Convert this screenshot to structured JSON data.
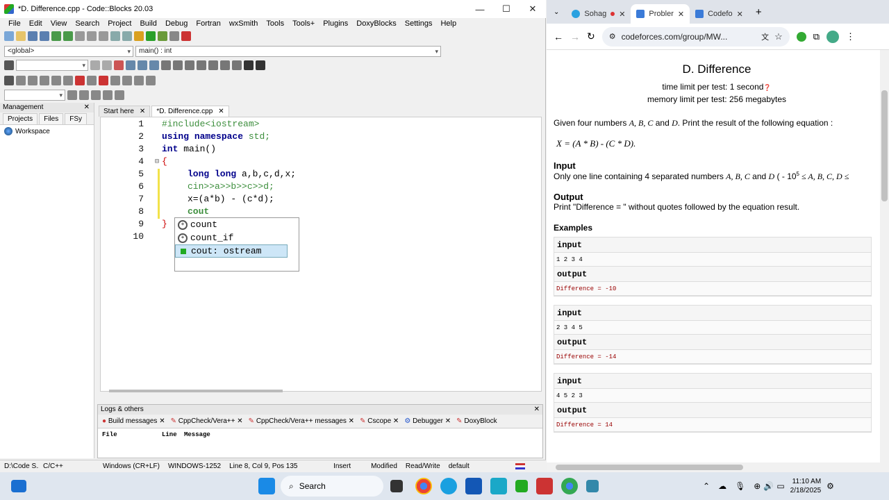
{
  "ide": {
    "window_title": "*D. Difference.cpp - Code::Blocks 20.03",
    "menu": [
      "File",
      "Edit",
      "View",
      "Search",
      "Project",
      "Build",
      "Debug",
      "Fortran",
      "wxSmith",
      "Tools",
      "Tools+",
      "Plugins",
      "DoxyBlocks",
      "Settings",
      "Help"
    ],
    "scope_combo": "<global>",
    "function_combo": "main() : int",
    "management": {
      "title": "Management",
      "tabs": [
        "Projects",
        "Files",
        "FSy"
      ],
      "tree_root": "Workspace"
    },
    "editor_tabs": [
      "Start here",
      "*D. Difference.cpp"
    ],
    "line_numbers": [
      "1",
      "2",
      "3",
      "4",
      "5",
      "6",
      "7",
      "8",
      "9",
      "10"
    ],
    "code": {
      "l1": "#include<iostream>",
      "l2_kw1": "using",
      "l2_kw2": "namespace",
      "l2_rest": "std;",
      "l3_kw": "int",
      "l3_rest": "main()",
      "l4": "{",
      "l5_kw": "long long",
      "l5_rest": "a,b,c,d,x;",
      "l6": "cin>>a>>b>>c>>d;",
      "l7": "x=(a*b) - (c*d);",
      "l8": "cout",
      "l9": "}"
    },
    "autocomplete": [
      "count",
      "count_if",
      "cout: ostream"
    ],
    "logs": {
      "title": "Logs & others",
      "tabs": [
        "Build messages",
        "CppCheck/Vera++",
        "CppCheck/Vera++ messages",
        "Cscope",
        "Debugger",
        "DoxyBlock"
      ],
      "columns": [
        "File",
        "Line",
        "Message"
      ]
    },
    "status": [
      "D:\\Code S...",
      "C/C++",
      "Windows (CR+LF)",
      "WINDOWS-1252",
      "Line 8, Col 9, Pos 135",
      "Insert",
      "Modified",
      "Read/Write",
      "default"
    ]
  },
  "browser": {
    "tabs": [
      "Sohag",
      "Probler",
      "Codefo"
    ],
    "url": "codeforces.com/group/MW...",
    "problem": {
      "title": "D. Difference",
      "time_limit": "time limit per test: 1 second",
      "memory_limit": "memory limit per test: 256 megabytes",
      "statement_pre": "Given four numbers ",
      "statement_vars": "A, B, C",
      "statement_and": " and ",
      "statement_d": "D",
      "statement_post": ". Print the result of the following equation :",
      "equation": "X = (A * B) - (C * D).",
      "input_title": "Input",
      "input_pre": "Only one line containing 4 separated numbers ",
      "input_vars": "A, B, C",
      "input_and": " and ",
      "input_d": "D",
      "input_range": " ( - 10",
      "input_exp": "5",
      "input_range2": " ≤ A, B, C, D ≤",
      "output_title": "Output",
      "output_text": "Print \"Difference = \" without quotes followed by the equation result.",
      "examples_title": "Examples",
      "examples": [
        {
          "input_label": "input",
          "input": "1 2 3 4",
          "output_label": "output",
          "output": "Difference = -10"
        },
        {
          "input_label": "input",
          "input": "2 3 4 5",
          "output_label": "output",
          "output": "Difference = -14"
        },
        {
          "input_label": "input",
          "input": "4 5 2 3",
          "output_label": "output",
          "output": "Difference = 14"
        }
      ]
    }
  },
  "taskbar": {
    "search": "Search",
    "time": "11:10 AM",
    "date": "2/18/2025"
  }
}
